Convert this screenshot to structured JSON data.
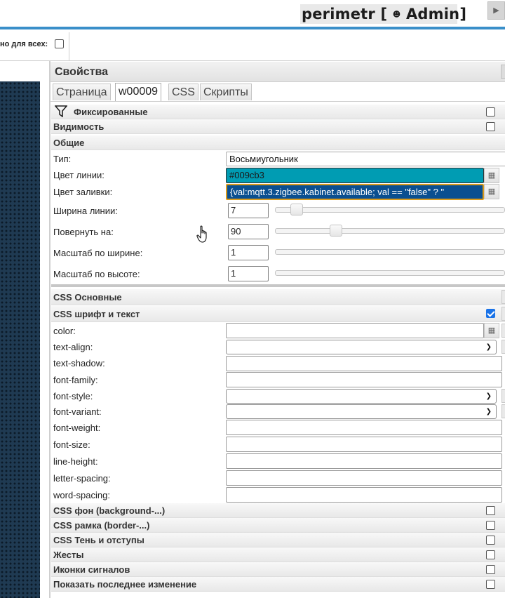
{
  "app": {
    "title_parts": {
      "name": "perimetr",
      "open": "[",
      "user": "Admin",
      "close": "]"
    }
  },
  "toolbar": {
    "visible_all_label": "но для всех:"
  },
  "panel": {
    "title": "Свойства",
    "tabs": [
      {
        "label": "Страница",
        "active": false
      },
      {
        "label": "w00009",
        "active": true
      },
      {
        "label": "CSS",
        "active": false
      },
      {
        "label": "Скрипты",
        "active": false
      }
    ],
    "sections": {
      "fixed": {
        "label": "Фиксированные",
        "checked": false
      },
      "visibility": {
        "label": "Видимость",
        "checked": false
      },
      "common": {
        "label": "Общие"
      },
      "css_main": {
        "label": "CSS Основные"
      },
      "css_font": {
        "label": "CSS шрифт и текст",
        "checked": true
      },
      "css_bg": {
        "label": "CSS фон (background-...)",
        "checked": false
      },
      "css_border": {
        "label": "CSS рамка (border-...)",
        "checked": false
      },
      "css_shadow": {
        "label": "CSS Тень и отступы",
        "checked": false
      },
      "gestures": {
        "label": "Жесты",
        "checked": false
      },
      "signal_icons": {
        "label": "Иконки сигналов",
        "checked": false
      },
      "last_change": {
        "label": "Показать последнее изменение",
        "checked": false
      }
    },
    "common": {
      "type_label": "Тип:",
      "type_value": "Восьмиугольник",
      "line_color_label": "Цвет линии:",
      "line_color_value": "#009cb3",
      "fill_color_label": "Цвет заливки:",
      "fill_color_value": "{val:mqtt.3.zigbee.kabinet.available; val == \"false\" ? \"",
      "line_width_label": "Ширина линии:",
      "line_width_value": "7",
      "rotate_label": "Повернуть на:",
      "rotate_value": "90",
      "scale_w_label": "Масштаб по ширине:",
      "scale_w_value": "1",
      "scale_h_label": "Масштаб по высоте:",
      "scale_h_value": "1"
    },
    "sliders": {
      "line_width_level": 0.07,
      "rotate_level": 0.25
    },
    "css_font_fields": [
      {
        "label": "color:",
        "kind": "text-with-button",
        "value": ""
      },
      {
        "label": "text-align:",
        "kind": "select",
        "value": ""
      },
      {
        "label": "text-shadow:",
        "kind": "text",
        "value": ""
      },
      {
        "label": "font-family:",
        "kind": "text",
        "value": ""
      },
      {
        "label": "font-style:",
        "kind": "select",
        "value": ""
      },
      {
        "label": "font-variant:",
        "kind": "select",
        "value": ""
      },
      {
        "label": "font-weight:",
        "kind": "text",
        "value": ""
      },
      {
        "label": "font-size:",
        "kind": "text",
        "value": ""
      },
      {
        "label": "line-height:",
        "kind": "text",
        "value": ""
      },
      {
        "label": "letter-spacing:",
        "kind": "text",
        "value": ""
      },
      {
        "label": "word-spacing:",
        "kind": "text",
        "value": ""
      }
    ]
  },
  "colors": {
    "line_color_swatch": "#009cb3",
    "fill_field_bg": "#0a4f90",
    "accent_blue": "#3a8fc9"
  },
  "icons": {
    "filter": "filter-icon",
    "user": "user-icon",
    "play": "play-icon",
    "color_picker": "color-picker-icon",
    "cursor": "hand-cursor-icon"
  }
}
